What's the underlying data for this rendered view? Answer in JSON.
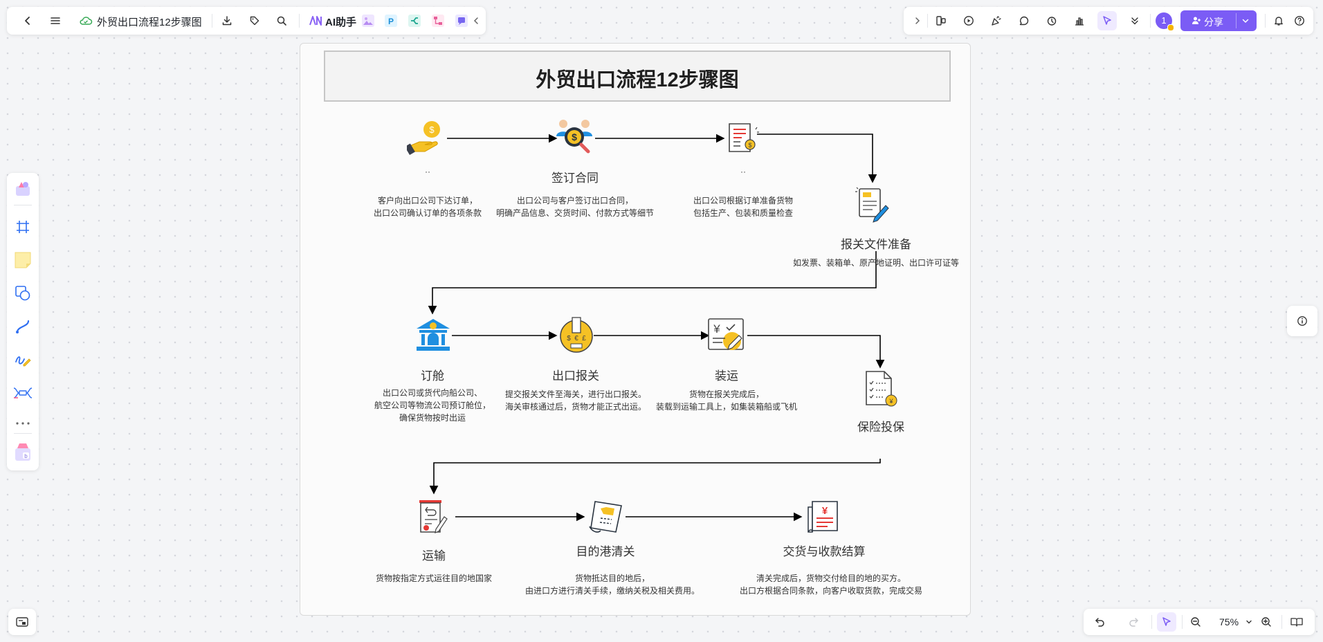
{
  "toolbar_left": {
    "doc_title": "外贸出口流程12步骤图",
    "ai_label": "AI助手"
  },
  "toolbar_right": {
    "avatar_count": "1",
    "share_label": "分享"
  },
  "zoom": {
    "level": "75%"
  },
  "board": {
    "title": "外贸出口流程12步骤图",
    "steps": [
      {
        "title": "··",
        "desc1": "客户向出口公司下达订单，",
        "desc2": "出口公司确认订单的各项条款",
        "desc3": ""
      },
      {
        "title": "签订合同",
        "desc1": "出口公司与客户签订出口合同，",
        "desc2": "明确产品信息、交货时间、付款方式等细节",
        "desc3": ""
      },
      {
        "title": "··",
        "desc1": "出口公司根据订单准备货物",
        "desc2": "包括生产、包装和质量检查",
        "desc3": ""
      },
      {
        "title": "报关文件准备",
        "desc1": "如发票、装箱单、原产地证明、出口许可证等",
        "desc2": "",
        "desc3": ""
      },
      {
        "title": "订舱",
        "desc1": "出口公司或货代向船公司、",
        "desc2": "航空公司等物流公司预订舱位，",
        "desc3": "确保货物按时出运"
      },
      {
        "title": "出口报关",
        "desc1": "提交报关文件至海关，进行出口报关。",
        "desc2": "海关审核通过后，货物才能正式出运。",
        "desc3": ""
      },
      {
        "title": "装运",
        "desc1": "货物在报关完成后，",
        "desc2": "装载到运输工具上，如集装箱船或飞机",
        "desc3": ""
      },
      {
        "title": "保险投保",
        "desc1": "",
        "desc2": "",
        "desc3": ""
      },
      {
        "title": "运输",
        "desc1": "货物按指定方式运往目的地国家",
        "desc2": "",
        "desc3": ""
      },
      {
        "title": "目的港清关",
        "desc1": "货物抵达目的地后，",
        "desc2": "由进口方进行清关手续，缴纳关税及相关费用。",
        "desc3": ""
      },
      {
        "title": "交货与收款结算",
        "desc1": "清关完成后，货物交付给目的地的买方。",
        "desc2": "出口方根据合同条款，向客户收取货款，完成交易",
        "desc3": ""
      }
    ]
  },
  "colors": {
    "accent": "#7b5cf5",
    "icon_yellow": "#f5c125",
    "icon_blue": "#1f8fe0",
    "icon_red": "#e53935",
    "connector": "#000000"
  }
}
